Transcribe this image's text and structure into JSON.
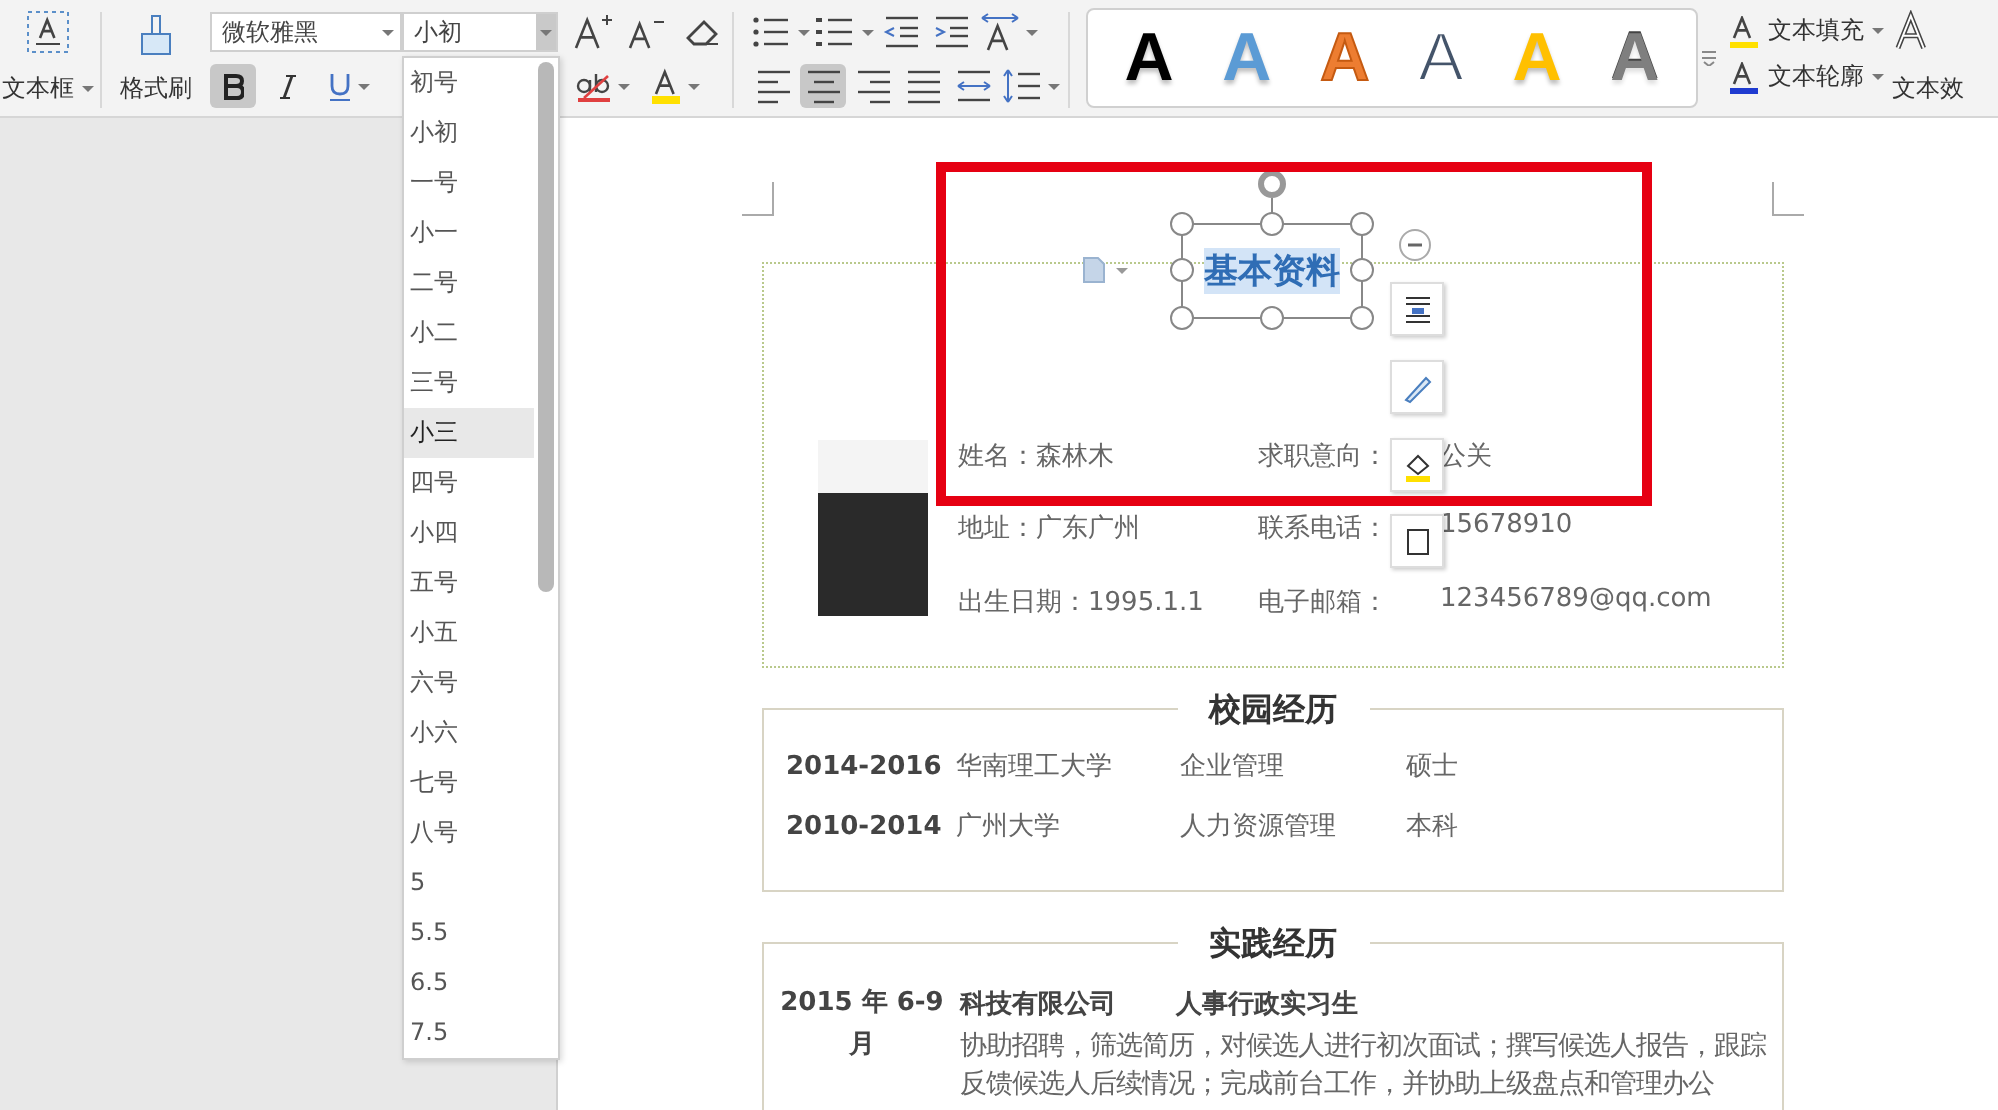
{
  "toolbar": {
    "textbox_label": "文本框",
    "format_painter_label": "格式刷",
    "font_name": "微软雅黑",
    "font_size": "小初",
    "bold_on": true,
    "align_buttons": [
      {
        "kind": "left",
        "selected": false
      },
      {
        "kind": "center",
        "selected": true
      },
      {
        "kind": "right",
        "selected": false
      },
      {
        "kind": "justify",
        "selected": false
      },
      {
        "kind": "distributed",
        "selected": false
      }
    ],
    "style_gallery": [
      {
        "letter": "A",
        "kind": "solid",
        "color": "#000000"
      },
      {
        "letter": "A",
        "kind": "solid",
        "color": "#5b9bd5"
      },
      {
        "letter": "A",
        "kind": "outlined",
        "color": "#ed7d31"
      },
      {
        "letter": "A",
        "kind": "hollow",
        "color": "#44546a"
      },
      {
        "letter": "A",
        "kind": "solid",
        "color": "#ffc000"
      },
      {
        "letter": "A",
        "kind": "gradient",
        "color": "#7f7f7f"
      }
    ],
    "text_fill_label": "文本填充",
    "text_outline_label": "文本轮廓",
    "text_effect_label": "文本效"
  },
  "size_dropdown": {
    "items": [
      {
        "label": "初号",
        "selected": false
      },
      {
        "label": "小初",
        "selected": false
      },
      {
        "label": "一号",
        "selected": false
      },
      {
        "label": "小一",
        "selected": false
      },
      {
        "label": "二号",
        "selected": false
      },
      {
        "label": "小二",
        "selected": false
      },
      {
        "label": "三号",
        "selected": false
      },
      {
        "label": "小三",
        "selected": true
      },
      {
        "label": "四号",
        "selected": false
      },
      {
        "label": "小四",
        "selected": false
      },
      {
        "label": "五号",
        "selected": false
      },
      {
        "label": "小五",
        "selected": false
      },
      {
        "label": "六号",
        "selected": false
      },
      {
        "label": "小六",
        "selected": false
      },
      {
        "label": "七号",
        "selected": false
      },
      {
        "label": "八号",
        "selected": false
      },
      {
        "label": "5",
        "selected": false
      },
      {
        "label": "5.5",
        "selected": false
      },
      {
        "label": "6.5",
        "selected": false
      },
      {
        "label": "7.5",
        "selected": false
      }
    ]
  },
  "document": {
    "title_box": {
      "text": "基本资料",
      "selected": true
    },
    "basic_info": {
      "rows": [
        {
          "left": "姓名：森林木",
          "right_label": "求职意向：",
          "right_value": "公关"
        },
        {
          "left": "地址：广东广州",
          "right_label": "联系电话：",
          "right_value": "15678910"
        },
        {
          "left": "出生日期：1995.1.1",
          "right_label": "电子邮箱：",
          "right_value": "123456789@qq.com"
        }
      ]
    },
    "education": {
      "title": "校园经历",
      "rows": [
        {
          "period": "2014-2016",
          "school": "华南理工大学",
          "major": "企业管理",
          "degree": "硕士"
        },
        {
          "period": "2010-2014",
          "school": "广州大学",
          "major": "人力资源管理",
          "degree": "本科"
        }
      ]
    },
    "practice": {
      "title": "实践经历",
      "rows": [
        {
          "period": "2015 年 6-9 月",
          "company": "科技有限公司",
          "role": "人事行政实习生",
          "description": "协助招聘，筛选简历，对候选人进行初次面试；撰写候选人报告，跟踪反馈候选人后续情况；完成前台工作，并协助上级盘点和管理办公"
        }
      ]
    }
  }
}
